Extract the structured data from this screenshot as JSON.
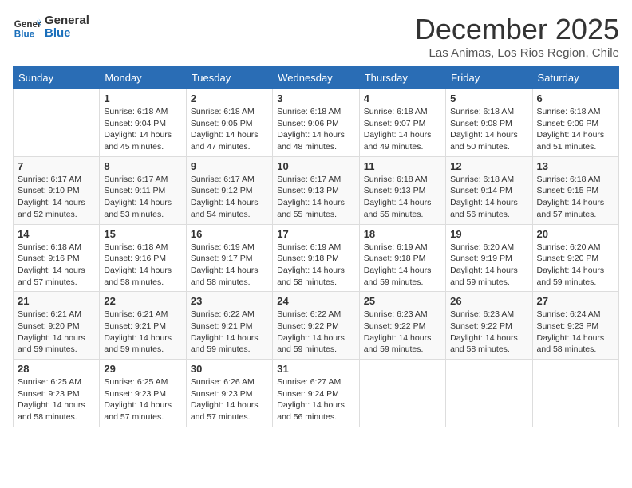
{
  "logo": {
    "text_general": "General",
    "text_blue": "Blue"
  },
  "header": {
    "month": "December 2025",
    "location": "Las Animas, Los Rios Region, Chile"
  },
  "days_of_week": [
    "Sunday",
    "Monday",
    "Tuesday",
    "Wednesday",
    "Thursday",
    "Friday",
    "Saturday"
  ],
  "weeks": [
    [
      {
        "day": "",
        "sunrise": "",
        "sunset": "",
        "daylight": ""
      },
      {
        "day": "1",
        "sunrise": "Sunrise: 6:18 AM",
        "sunset": "Sunset: 9:04 PM",
        "daylight": "Daylight: 14 hours and 45 minutes."
      },
      {
        "day": "2",
        "sunrise": "Sunrise: 6:18 AM",
        "sunset": "Sunset: 9:05 PM",
        "daylight": "Daylight: 14 hours and 47 minutes."
      },
      {
        "day": "3",
        "sunrise": "Sunrise: 6:18 AM",
        "sunset": "Sunset: 9:06 PM",
        "daylight": "Daylight: 14 hours and 48 minutes."
      },
      {
        "day": "4",
        "sunrise": "Sunrise: 6:18 AM",
        "sunset": "Sunset: 9:07 PM",
        "daylight": "Daylight: 14 hours and 49 minutes."
      },
      {
        "day": "5",
        "sunrise": "Sunrise: 6:18 AM",
        "sunset": "Sunset: 9:08 PM",
        "daylight": "Daylight: 14 hours and 50 minutes."
      },
      {
        "day": "6",
        "sunrise": "Sunrise: 6:18 AM",
        "sunset": "Sunset: 9:09 PM",
        "daylight": "Daylight: 14 hours and 51 minutes."
      }
    ],
    [
      {
        "day": "7",
        "sunrise": "Sunrise: 6:17 AM",
        "sunset": "Sunset: 9:10 PM",
        "daylight": "Daylight: 14 hours and 52 minutes."
      },
      {
        "day": "8",
        "sunrise": "Sunrise: 6:17 AM",
        "sunset": "Sunset: 9:11 PM",
        "daylight": "Daylight: 14 hours and 53 minutes."
      },
      {
        "day": "9",
        "sunrise": "Sunrise: 6:17 AM",
        "sunset": "Sunset: 9:12 PM",
        "daylight": "Daylight: 14 hours and 54 minutes."
      },
      {
        "day": "10",
        "sunrise": "Sunrise: 6:17 AM",
        "sunset": "Sunset: 9:13 PM",
        "daylight": "Daylight: 14 hours and 55 minutes."
      },
      {
        "day": "11",
        "sunrise": "Sunrise: 6:18 AM",
        "sunset": "Sunset: 9:13 PM",
        "daylight": "Daylight: 14 hours and 55 minutes."
      },
      {
        "day": "12",
        "sunrise": "Sunrise: 6:18 AM",
        "sunset": "Sunset: 9:14 PM",
        "daylight": "Daylight: 14 hours and 56 minutes."
      },
      {
        "day": "13",
        "sunrise": "Sunrise: 6:18 AM",
        "sunset": "Sunset: 9:15 PM",
        "daylight": "Daylight: 14 hours and 57 minutes."
      }
    ],
    [
      {
        "day": "14",
        "sunrise": "Sunrise: 6:18 AM",
        "sunset": "Sunset: 9:16 PM",
        "daylight": "Daylight: 14 hours and 57 minutes."
      },
      {
        "day": "15",
        "sunrise": "Sunrise: 6:18 AM",
        "sunset": "Sunset: 9:16 PM",
        "daylight": "Daylight: 14 hours and 58 minutes."
      },
      {
        "day": "16",
        "sunrise": "Sunrise: 6:19 AM",
        "sunset": "Sunset: 9:17 PM",
        "daylight": "Daylight: 14 hours and 58 minutes."
      },
      {
        "day": "17",
        "sunrise": "Sunrise: 6:19 AM",
        "sunset": "Sunset: 9:18 PM",
        "daylight": "Daylight: 14 hours and 58 minutes."
      },
      {
        "day": "18",
        "sunrise": "Sunrise: 6:19 AM",
        "sunset": "Sunset: 9:18 PM",
        "daylight": "Daylight: 14 hours and 59 minutes."
      },
      {
        "day": "19",
        "sunrise": "Sunrise: 6:20 AM",
        "sunset": "Sunset: 9:19 PM",
        "daylight": "Daylight: 14 hours and 59 minutes."
      },
      {
        "day": "20",
        "sunrise": "Sunrise: 6:20 AM",
        "sunset": "Sunset: 9:20 PM",
        "daylight": "Daylight: 14 hours and 59 minutes."
      }
    ],
    [
      {
        "day": "21",
        "sunrise": "Sunrise: 6:21 AM",
        "sunset": "Sunset: 9:20 PM",
        "daylight": "Daylight: 14 hours and 59 minutes."
      },
      {
        "day": "22",
        "sunrise": "Sunrise: 6:21 AM",
        "sunset": "Sunset: 9:21 PM",
        "daylight": "Daylight: 14 hours and 59 minutes."
      },
      {
        "day": "23",
        "sunrise": "Sunrise: 6:22 AM",
        "sunset": "Sunset: 9:21 PM",
        "daylight": "Daylight: 14 hours and 59 minutes."
      },
      {
        "day": "24",
        "sunrise": "Sunrise: 6:22 AM",
        "sunset": "Sunset: 9:22 PM",
        "daylight": "Daylight: 14 hours and 59 minutes."
      },
      {
        "day": "25",
        "sunrise": "Sunrise: 6:23 AM",
        "sunset": "Sunset: 9:22 PM",
        "daylight": "Daylight: 14 hours and 59 minutes."
      },
      {
        "day": "26",
        "sunrise": "Sunrise: 6:23 AM",
        "sunset": "Sunset: 9:22 PM",
        "daylight": "Daylight: 14 hours and 58 minutes."
      },
      {
        "day": "27",
        "sunrise": "Sunrise: 6:24 AM",
        "sunset": "Sunset: 9:23 PM",
        "daylight": "Daylight: 14 hours and 58 minutes."
      }
    ],
    [
      {
        "day": "28",
        "sunrise": "Sunrise: 6:25 AM",
        "sunset": "Sunset: 9:23 PM",
        "daylight": "Daylight: 14 hours and 58 minutes."
      },
      {
        "day": "29",
        "sunrise": "Sunrise: 6:25 AM",
        "sunset": "Sunset: 9:23 PM",
        "daylight": "Daylight: 14 hours and 57 minutes."
      },
      {
        "day": "30",
        "sunrise": "Sunrise: 6:26 AM",
        "sunset": "Sunset: 9:23 PM",
        "daylight": "Daylight: 14 hours and 57 minutes."
      },
      {
        "day": "31",
        "sunrise": "Sunrise: 6:27 AM",
        "sunset": "Sunset: 9:24 PM",
        "daylight": "Daylight: 14 hours and 56 minutes."
      },
      {
        "day": "",
        "sunrise": "",
        "sunset": "",
        "daylight": ""
      },
      {
        "day": "",
        "sunrise": "",
        "sunset": "",
        "daylight": ""
      },
      {
        "day": "",
        "sunrise": "",
        "sunset": "",
        "daylight": ""
      }
    ]
  ]
}
